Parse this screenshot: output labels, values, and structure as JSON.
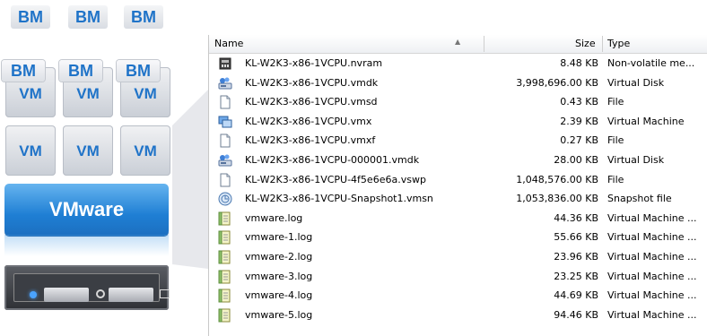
{
  "diagram": {
    "top_bm": [
      "BM",
      "BM",
      "BM"
    ],
    "row1": [
      {
        "top": "BM",
        "bottom": "VM"
      },
      {
        "top": "BM",
        "bottom": "VM"
      },
      {
        "top": "BM",
        "bottom": "VM"
      }
    ],
    "row2": [
      "VM",
      "VM",
      "VM"
    ],
    "hypervisor": "VMware",
    "colors": {
      "accent": "#1f73c8",
      "hypervisor": "#1f7fd4",
      "server": "#3b3e44",
      "led": "#4aa3ff"
    }
  },
  "explorer": {
    "columns": {
      "name": "Name",
      "size": "Size",
      "type": "Type"
    },
    "files": [
      {
        "icon": "nvram-icon",
        "name": "KL-W2K3-x86-1VCPU.nvram",
        "size": "8.48 KB",
        "type": "Non-volatile me..."
      },
      {
        "icon": "virtual-disk-icon",
        "name": "KL-W2K3-x86-1VCPU.vmdk",
        "size": "3,998,696.00 KB",
        "type": "Virtual Disk"
      },
      {
        "icon": "file-icon",
        "name": "KL-W2K3-x86-1VCPU.vmsd",
        "size": "0.43 KB",
        "type": "File"
      },
      {
        "icon": "virtual-machine-icon",
        "name": "KL-W2K3-x86-1VCPU.vmx",
        "size": "2.39 KB",
        "type": "Virtual Machine"
      },
      {
        "icon": "file-icon",
        "name": "KL-W2K3-x86-1VCPU.vmxf",
        "size": "0.27 KB",
        "type": "File"
      },
      {
        "icon": "virtual-disk-icon",
        "name": "KL-W2K3-x86-1VCPU-000001.vmdk",
        "size": "28.00 KB",
        "type": "Virtual Disk"
      },
      {
        "icon": "file-icon",
        "name": "KL-W2K3-x86-1VCPU-4f5e6e6a.vswp",
        "size": "1,048,576.00 KB",
        "type": "File"
      },
      {
        "icon": "snapshot-icon",
        "name": "KL-W2K3-x86-1VCPU-Snapshot1.vmsn",
        "size": "1,053,836.00 KB",
        "type": "Snapshot file"
      },
      {
        "icon": "log-icon",
        "name": "vmware.log",
        "size": "44.36 KB",
        "type": "Virtual Machine ..."
      },
      {
        "icon": "log-icon",
        "name": "vmware-1.log",
        "size": "55.66 KB",
        "type": "Virtual Machine ..."
      },
      {
        "icon": "log-icon",
        "name": "vmware-2.log",
        "size": "23.96 KB",
        "type": "Virtual Machine ..."
      },
      {
        "icon": "log-icon",
        "name": "vmware-3.log",
        "size": "23.25 KB",
        "type": "Virtual Machine ..."
      },
      {
        "icon": "log-icon",
        "name": "vmware-4.log",
        "size": "44.69 KB",
        "type": "Virtual Machine ..."
      },
      {
        "icon": "log-icon",
        "name": "vmware-5.log",
        "size": "94.46 KB",
        "type": "Virtual Machine ..."
      }
    ]
  }
}
